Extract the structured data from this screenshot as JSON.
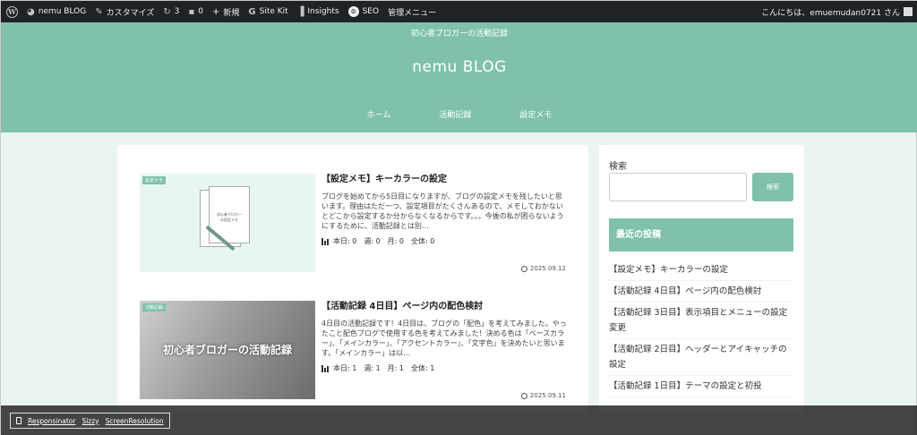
{
  "adminbar": {
    "site": "nemu BLOG",
    "customize": "カスタマイズ",
    "updates": "3",
    "comments": "0",
    "new": "新規",
    "sitekit": "Site Kit",
    "insights": "Insights",
    "seo": "SEO",
    "admin_menu": "管理メニュー",
    "greeting": "こんにちは、emuemudan0721 さん"
  },
  "header": {
    "tagline": "初心者ブロガーの活動記録",
    "title": "nemu BLOG",
    "nav": [
      "ホーム",
      "活動記録",
      "設定メモ"
    ]
  },
  "posts": [
    {
      "category": "設定メモ",
      "thumb_text_1": "初心者ブロガー",
      "thumb_text_2": "の設定メモ",
      "title": "【設定メモ】キーカラーの設定",
      "excerpt": "ブログを始めてから5日目になりますが、ブログの設定メモを残したいと思います。理由はただ一つ、設定項目がたくさんあるので、メモしておかないとどこから設定するか分からなくなるからです。。。今後の私が困らないようにするために、活動記録とは別…",
      "stats": "本日: 0　週: 0　月: 0　全体: 0",
      "date": "2025.09.12"
    },
    {
      "category": "活動記録",
      "thumb_text": "初心者ブロガーの活動記録",
      "title": "【活動記録 4日目】ページ内の配色検討",
      "excerpt": "4日目の活動記録です！4日目は、ブログの「配色」を考えてみました。やったこと配色ブログで使用する色を考えてみました！決める色は「ベースカラー」、「メインカラー」、「アクセントカラー」、「文字色」を決めたいと思います。「メインカラー」は以…",
      "stats": "本日: 1　週: 1　月: 1　全体: 1",
      "date": "2025.09.11"
    }
  ],
  "sidebar": {
    "search_label": "検索",
    "search_value": "",
    "search_button": "検索",
    "recent_title": "最近の投稿",
    "recent": [
      "【設定メモ】キーカラーの設定",
      "【活動記録 4日目】ページ内の配色検討",
      "【活動記録 3日目】表示項目とメニューの設定変更",
      "【活動記録 2日目】ヘッダーとアイキャッチの設定",
      "【活動記録 1日目】テーマの設定と初投"
    ]
  },
  "debug": {
    "responsinator": "Responsinator",
    "sizzy": "Sizzy",
    "screenresolution": "ScreenResolution"
  },
  "colors": {
    "accent": "#7fc1ad",
    "adminbar": "#1d2327",
    "background": "#eaf5f1"
  }
}
